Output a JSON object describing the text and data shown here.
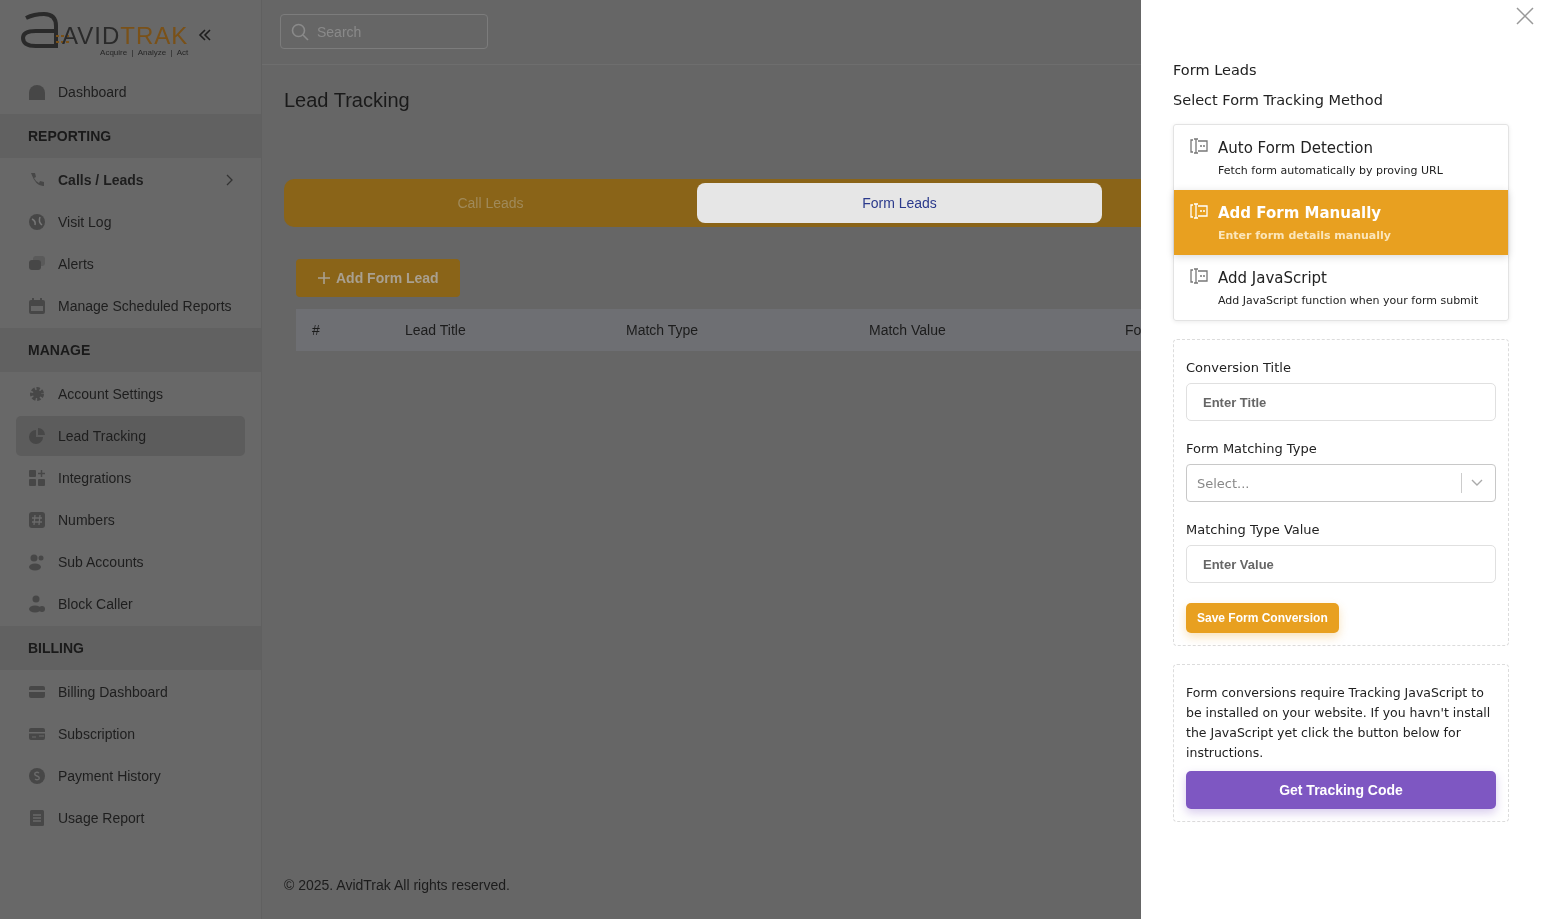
{
  "sidebar": {
    "logo": {
      "primary": "AVID",
      "secondary": "TRAK",
      "tagline": "Acquire  |  Analyze  |  Act"
    },
    "items": [
      {
        "kind": "link",
        "label": "Dashboard",
        "selected": false
      },
      {
        "kind": "section",
        "label": "REPORTING"
      },
      {
        "kind": "link",
        "label": "Calls / Leads",
        "selected": false,
        "submenu": true
      },
      {
        "kind": "link",
        "label": "Visit Log",
        "selected": false
      },
      {
        "kind": "link",
        "label": "Alerts",
        "selected": false
      },
      {
        "kind": "link",
        "label": "Manage Scheduled Reports",
        "selected": false
      },
      {
        "kind": "section",
        "label": "MANAGE"
      },
      {
        "kind": "link",
        "label": "Account Settings",
        "selected": false
      },
      {
        "kind": "link",
        "label": "Lead Tracking",
        "selected": true
      },
      {
        "kind": "link",
        "label": "Integrations",
        "selected": false
      },
      {
        "kind": "link",
        "label": "Numbers",
        "selected": false
      },
      {
        "kind": "link",
        "label": "Sub Accounts",
        "selected": false
      },
      {
        "kind": "link",
        "label": "Block Caller",
        "selected": false
      },
      {
        "kind": "section",
        "label": "BILLING"
      },
      {
        "kind": "link",
        "label": "Billing Dashboard",
        "selected": false
      },
      {
        "kind": "link",
        "label": "Subscription",
        "selected": false
      },
      {
        "kind": "link",
        "label": "Payment History",
        "selected": false
      },
      {
        "kind": "link",
        "label": "Usage Report",
        "selected": false
      }
    ]
  },
  "main": {
    "search": {
      "placeholder": "Search"
    },
    "page_title": "Lead Tracking",
    "tabs": [
      {
        "label": "Call Leads",
        "selected": false
      },
      {
        "label": "Form Leads",
        "selected": true
      }
    ],
    "add_button": "Add Form Lead",
    "table": {
      "columns": [
        "#",
        "Lead Title",
        "Match Type",
        "Match Value",
        "Fo"
      ]
    },
    "footer": "© 2025. AvidTrak All rights reserved."
  },
  "drawer": {
    "title": "Form Leads",
    "subtitle": "Select Form Tracking Method",
    "methods": [
      {
        "title": "Auto Form Detection",
        "description": "Fetch form automatically by proving URL",
        "selected": false
      },
      {
        "title": "Add Form Manually",
        "description": "Enter form details manually",
        "selected": true
      },
      {
        "title": "Add JavaScript",
        "description": "Add JavaScript function when your form submit",
        "selected": false
      }
    ],
    "fields": [
      {
        "kind": "text",
        "label": "Conversion Title",
        "placeholder": "Enter Title"
      },
      {
        "kind": "select",
        "label": "Form Matching Type",
        "placeholder": "Select..."
      },
      {
        "kind": "text",
        "label": "Matching Type Value",
        "placeholder": "Enter Value"
      }
    ],
    "save_button": "Save Form Conversion",
    "info": "Form conversions require Tracking JavaScript to be installed on your website. If you havn't install the JavaScript yet click the button below for instructions.",
    "tracking_button": "Get Tracking Code"
  }
}
